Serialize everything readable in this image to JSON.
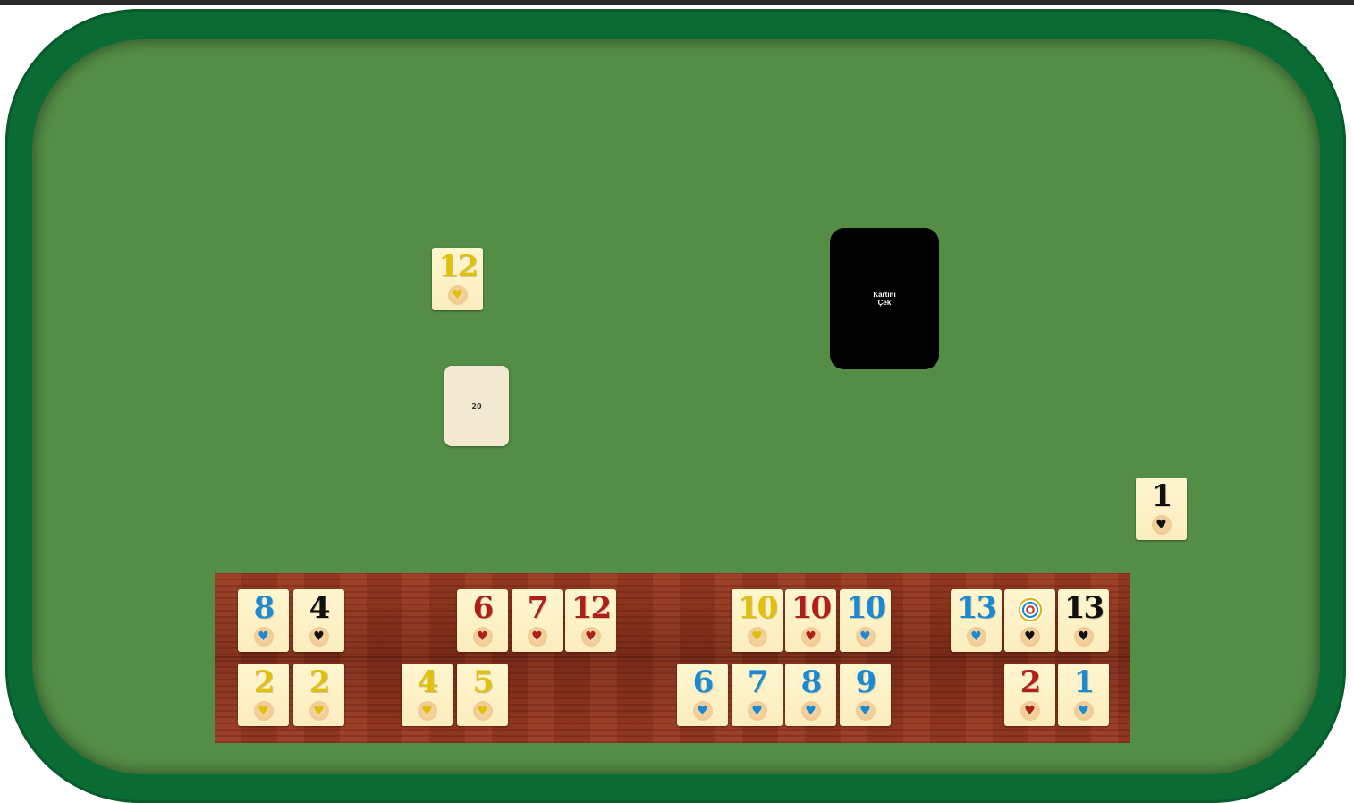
{
  "draw_pile": {
    "label": "Kartını\nÇek"
  },
  "counter": {
    "remaining": "20"
  },
  "indicator_tile": {
    "number": "12",
    "color": "yellow",
    "suit_icon": "heart-icon"
  },
  "discard_tile": {
    "number": "1",
    "color": "black",
    "suit_icon": "heart-icon"
  },
  "rack": {
    "top_row": [
      {
        "number": "8",
        "color": "blue"
      },
      {
        "number": "4",
        "color": "black"
      },
      {
        "number": "6",
        "color": "red"
      },
      {
        "number": "7",
        "color": "red"
      },
      {
        "number": "12",
        "color": "red"
      },
      {
        "number": "10",
        "color": "yellow"
      },
      {
        "number": "10",
        "color": "red"
      },
      {
        "number": "10",
        "color": "blue"
      },
      {
        "number": "13",
        "color": "blue"
      },
      {
        "number": "",
        "color": "black",
        "joker": true
      },
      {
        "number": "13",
        "color": "black"
      }
    ],
    "bottom_row": [
      {
        "number": "2",
        "color": "yellow"
      },
      {
        "number": "2",
        "color": "yellow"
      },
      {
        "number": "4",
        "color": "yellow"
      },
      {
        "number": "5",
        "color": "yellow"
      },
      {
        "number": "6",
        "color": "blue"
      },
      {
        "number": "7",
        "color": "blue"
      },
      {
        "number": "8",
        "color": "blue"
      },
      {
        "number": "9",
        "color": "blue"
      },
      {
        "number": "2",
        "color": "red"
      },
      {
        "number": "1",
        "color": "blue"
      }
    ]
  },
  "colors": {
    "blue": "#1a8ad4",
    "black": "#111111",
    "red": "#b0201b",
    "yellow": "#e1c00b",
    "felt": "#548e46",
    "rim": "#0a6c34"
  }
}
